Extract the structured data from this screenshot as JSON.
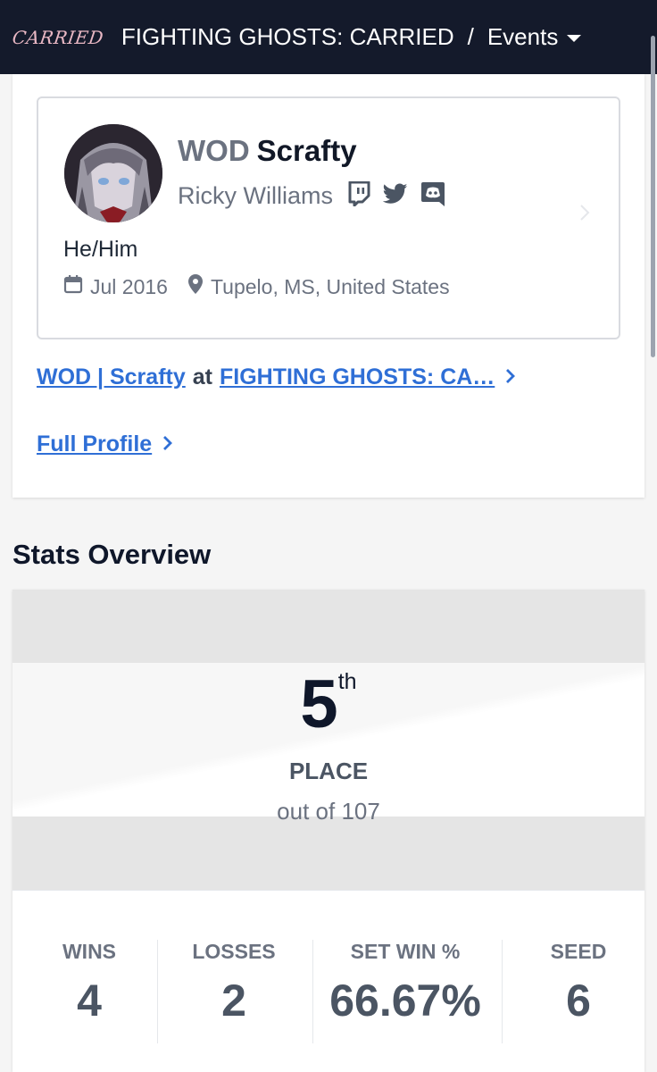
{
  "header": {
    "logo_text": "CARRIED",
    "event_name": "FIGHTING GHOSTS: CARRIED",
    "separator": "/",
    "section_label": "Events"
  },
  "profile": {
    "prefix": "WOD",
    "gamer_tag": "Scrafty",
    "real_name": "Ricky Williams",
    "socials": [
      "twitch-icon",
      "twitter-icon",
      "discord-icon"
    ],
    "pronouns": "He/Him",
    "joined": "Jul 2016",
    "location": "Tupelo, MS, United States"
  },
  "links": {
    "entrant_name": "WOD | Scrafty",
    "at_word": "at",
    "event_truncated": "FIGHTING GHOSTS: CA…",
    "full_profile": "Full Profile"
  },
  "stats": {
    "title": "Stats Overview",
    "placement": "5",
    "placement_suffix": "th",
    "placement_label": "PLACE",
    "out_of": "out of 107",
    "items": [
      {
        "label": "WINS",
        "value": "4"
      },
      {
        "label": "LOSSES",
        "value": "2"
      },
      {
        "label": "SET WIN %",
        "value": "66.67%"
      },
      {
        "label": "SEED",
        "value": "6"
      }
    ]
  },
  "colors": {
    "header_bg": "#141a2b",
    "link": "#2f6fd6",
    "logo": "#e9b8c4"
  }
}
